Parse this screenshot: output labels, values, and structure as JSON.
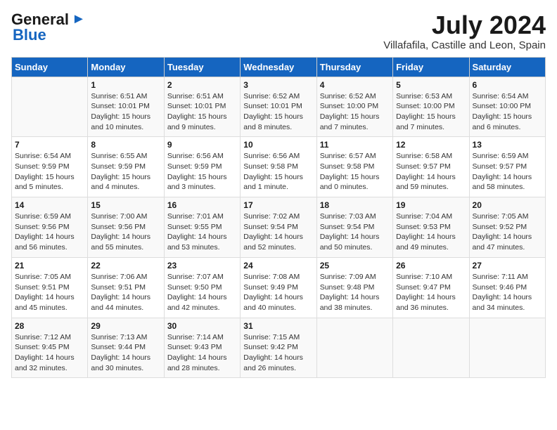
{
  "logo": {
    "general": "General",
    "blue": "Blue"
  },
  "title": "July 2024",
  "subtitle": "Villafafila, Castille and Leon, Spain",
  "headers": [
    "Sunday",
    "Monday",
    "Tuesday",
    "Wednesday",
    "Thursday",
    "Friday",
    "Saturday"
  ],
  "weeks": [
    [
      {
        "day": "",
        "info": ""
      },
      {
        "day": "1",
        "info": "Sunrise: 6:51 AM\nSunset: 10:01 PM\nDaylight: 15 hours\nand 10 minutes."
      },
      {
        "day": "2",
        "info": "Sunrise: 6:51 AM\nSunset: 10:01 PM\nDaylight: 15 hours\nand 9 minutes."
      },
      {
        "day": "3",
        "info": "Sunrise: 6:52 AM\nSunset: 10:01 PM\nDaylight: 15 hours\nand 8 minutes."
      },
      {
        "day": "4",
        "info": "Sunrise: 6:52 AM\nSunset: 10:00 PM\nDaylight: 15 hours\nand 7 minutes."
      },
      {
        "day": "5",
        "info": "Sunrise: 6:53 AM\nSunset: 10:00 PM\nDaylight: 15 hours\nand 7 minutes."
      },
      {
        "day": "6",
        "info": "Sunrise: 6:54 AM\nSunset: 10:00 PM\nDaylight: 15 hours\nand 6 minutes."
      }
    ],
    [
      {
        "day": "7",
        "info": "Sunrise: 6:54 AM\nSunset: 9:59 PM\nDaylight: 15 hours\nand 5 minutes."
      },
      {
        "day": "8",
        "info": "Sunrise: 6:55 AM\nSunset: 9:59 PM\nDaylight: 15 hours\nand 4 minutes."
      },
      {
        "day": "9",
        "info": "Sunrise: 6:56 AM\nSunset: 9:59 PM\nDaylight: 15 hours\nand 3 minutes."
      },
      {
        "day": "10",
        "info": "Sunrise: 6:56 AM\nSunset: 9:58 PM\nDaylight: 15 hours\nand 1 minute."
      },
      {
        "day": "11",
        "info": "Sunrise: 6:57 AM\nSunset: 9:58 PM\nDaylight: 15 hours\nand 0 minutes."
      },
      {
        "day": "12",
        "info": "Sunrise: 6:58 AM\nSunset: 9:57 PM\nDaylight: 14 hours\nand 59 minutes."
      },
      {
        "day": "13",
        "info": "Sunrise: 6:59 AM\nSunset: 9:57 PM\nDaylight: 14 hours\nand 58 minutes."
      }
    ],
    [
      {
        "day": "14",
        "info": "Sunrise: 6:59 AM\nSunset: 9:56 PM\nDaylight: 14 hours\nand 56 minutes."
      },
      {
        "day": "15",
        "info": "Sunrise: 7:00 AM\nSunset: 9:56 PM\nDaylight: 14 hours\nand 55 minutes."
      },
      {
        "day": "16",
        "info": "Sunrise: 7:01 AM\nSunset: 9:55 PM\nDaylight: 14 hours\nand 53 minutes."
      },
      {
        "day": "17",
        "info": "Sunrise: 7:02 AM\nSunset: 9:54 PM\nDaylight: 14 hours\nand 52 minutes."
      },
      {
        "day": "18",
        "info": "Sunrise: 7:03 AM\nSunset: 9:54 PM\nDaylight: 14 hours\nand 50 minutes."
      },
      {
        "day": "19",
        "info": "Sunrise: 7:04 AM\nSunset: 9:53 PM\nDaylight: 14 hours\nand 49 minutes."
      },
      {
        "day": "20",
        "info": "Sunrise: 7:05 AM\nSunset: 9:52 PM\nDaylight: 14 hours\nand 47 minutes."
      }
    ],
    [
      {
        "day": "21",
        "info": "Sunrise: 7:05 AM\nSunset: 9:51 PM\nDaylight: 14 hours\nand 45 minutes."
      },
      {
        "day": "22",
        "info": "Sunrise: 7:06 AM\nSunset: 9:51 PM\nDaylight: 14 hours\nand 44 minutes."
      },
      {
        "day": "23",
        "info": "Sunrise: 7:07 AM\nSunset: 9:50 PM\nDaylight: 14 hours\nand 42 minutes."
      },
      {
        "day": "24",
        "info": "Sunrise: 7:08 AM\nSunset: 9:49 PM\nDaylight: 14 hours\nand 40 minutes."
      },
      {
        "day": "25",
        "info": "Sunrise: 7:09 AM\nSunset: 9:48 PM\nDaylight: 14 hours\nand 38 minutes."
      },
      {
        "day": "26",
        "info": "Sunrise: 7:10 AM\nSunset: 9:47 PM\nDaylight: 14 hours\nand 36 minutes."
      },
      {
        "day": "27",
        "info": "Sunrise: 7:11 AM\nSunset: 9:46 PM\nDaylight: 14 hours\nand 34 minutes."
      }
    ],
    [
      {
        "day": "28",
        "info": "Sunrise: 7:12 AM\nSunset: 9:45 PM\nDaylight: 14 hours\nand 32 minutes."
      },
      {
        "day": "29",
        "info": "Sunrise: 7:13 AM\nSunset: 9:44 PM\nDaylight: 14 hours\nand 30 minutes."
      },
      {
        "day": "30",
        "info": "Sunrise: 7:14 AM\nSunset: 9:43 PM\nDaylight: 14 hours\nand 28 minutes."
      },
      {
        "day": "31",
        "info": "Sunrise: 7:15 AM\nSunset: 9:42 PM\nDaylight: 14 hours\nand 26 minutes."
      },
      {
        "day": "",
        "info": ""
      },
      {
        "day": "",
        "info": ""
      },
      {
        "day": "",
        "info": ""
      }
    ]
  ]
}
